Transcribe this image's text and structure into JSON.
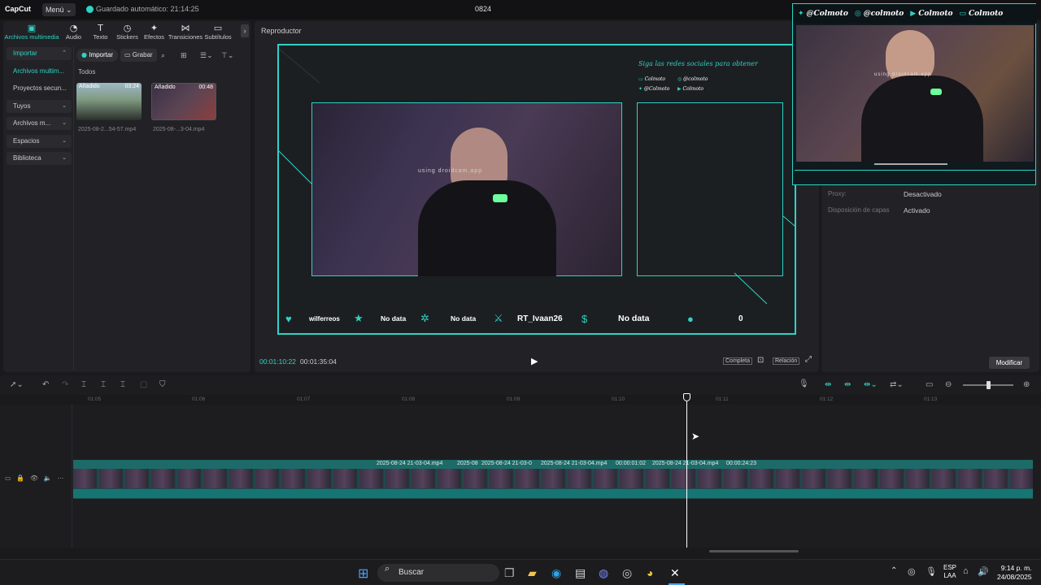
{
  "app": {
    "logo": "CapCut",
    "menu": "Menú",
    "autosave": "Guardado automático: 21:14:25",
    "project_title": "0824"
  },
  "tabs": [
    {
      "label": "Archivos multimedia",
      "icon": "media-icon"
    },
    {
      "label": "Audio",
      "icon": "audio-icon"
    },
    {
      "label": "Texto",
      "icon": "text-icon"
    },
    {
      "label": "Stickers",
      "icon": "sticker-icon"
    },
    {
      "label": "Efectos",
      "icon": "effects-icon"
    },
    {
      "label": "Transiciones",
      "icon": "transition-icon"
    },
    {
      "label": "Subtítulos",
      "icon": "subtitle-icon"
    }
  ],
  "sidebar": {
    "items": [
      {
        "label": "Importar"
      },
      {
        "label": "Archivos multim..."
      },
      {
        "label": "Proyectos secun..."
      },
      {
        "label": "Tuyos"
      },
      {
        "label": "Archivos m..."
      },
      {
        "label": "Espacios"
      },
      {
        "label": "Biblioteca"
      }
    ]
  },
  "media": {
    "import": "Importar",
    "record": "Grabar",
    "all": "Todos",
    "items": [
      {
        "tag": "Añadido",
        "duration": "03:24",
        "name": "2025-08-2...54-57.mp4"
      },
      {
        "tag": "Añadido",
        "duration": "00:48",
        "name": "2025-08-...3-04.mp4"
      }
    ]
  },
  "player": {
    "title": "Reproductor",
    "current_time": "00:01:10:22",
    "total_time": "00:01:35:04",
    "full": "Completa",
    "ratio": "Relación",
    "overlay": {
      "social_title": "Siga las redes sociales para obtener",
      "socials": [
        "Colmoto",
        "@colmoto",
        "@Colmoto",
        "Colmoto"
      ],
      "watermark": "using droidcam.app",
      "stats": [
        "wilferreos",
        "No data",
        "No data",
        "RT_Ivaan26",
        "No data",
        "0"
      ]
    }
  },
  "obs_overlay": {
    "socials": [
      "@Colmoto",
      "@colmoto",
      "Colmoto",
      "Colmoto"
    ],
    "watermark": "using droidcam.app"
  },
  "properties": {
    "proxy_label": "Proxy:",
    "proxy_value": "Desactivado",
    "layers_label": "Disposición de capas",
    "layers_value": "Activado",
    "modify": "Modificar"
  },
  "timeline": {
    "ruler": [
      "01:05",
      "01:06",
      "01:07",
      "01:08",
      "01:09",
      "01:10",
      "01:11",
      "01:12",
      "01:13"
    ],
    "clips": [
      "2025-08-24 21-03-04.mp4",
      "2025-08",
      "2025-08-24 21-03-0",
      "2025-08-24 21-03-04.mp4",
      "00:00:01:02",
      "2025-08-24 21-03-04.mp4",
      "00:00:24:23"
    ]
  },
  "taskbar": {
    "search": "Buscar",
    "lang1": "ESP",
    "lang2": "LAA",
    "time": "9:14 p. m.",
    "date": "24/08/2025"
  },
  "colors": {
    "accent": "#2ed3c4",
    "bg": "#1a1a1d"
  }
}
